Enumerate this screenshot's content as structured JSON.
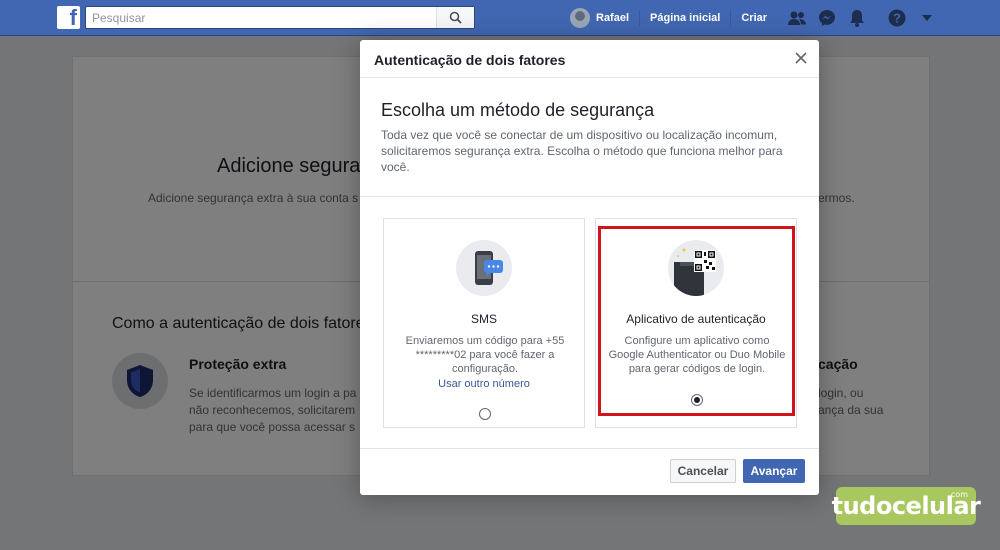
{
  "topbar": {
    "search_placeholder": "Pesquisar",
    "user_name": "Rafael",
    "home_label": "Página inicial",
    "create_label": "Criar",
    "brand_color": "#4267b2",
    "icons": [
      "friends-icon",
      "messenger-icon",
      "notifications-icon",
      "help-icon",
      "caret-down-icon"
    ]
  },
  "background_page": {
    "title_fragment": "Adicione seguranç",
    "subtitle_fragment": "Adicione segurança extra à sua conta s",
    "subtitle_right_fragment": "ermos.",
    "how_title_fragment": "Como a autenticação de dois fatore",
    "protection_title": "Proteção extra",
    "protection_text_lines": [
      "Se identificarmos um login a pa",
      "não reconhecemos, solicitarem",
      "para que você possa acessar s"
    ],
    "right_title_fragment": "cação",
    "right_text_lines": [
      "login, ou",
      "ança da sua"
    ]
  },
  "dialog": {
    "title": "Autenticação de dois fatores",
    "heading": "Escolha um método de segurança",
    "description": "Toda vez que você se conectar de um dispositivo ou localização incomum, solicitaremos segurança extra. Escolha o método que funciona melhor para você.",
    "options": [
      {
        "title": "SMS",
        "text": "Enviaremos um código para +55 *********02 para você fazer a configuração.",
        "link": "Usar outro número",
        "selected": false,
        "icon": "phone-sms-icon"
      },
      {
        "title": "Aplicativo de autenticação",
        "text": "Configure um aplicativo como Google Authenticator ou Duo Mobile para gerar códigos de login.",
        "selected": true,
        "icon": "qr-code-icon"
      }
    ],
    "cancel_label": "Cancelar",
    "next_label": "Avançar",
    "highlight_color": "#d0141c"
  },
  "watermark": {
    "text": "tudocelular",
    "suffix": ".com",
    "color": "#a9c75f"
  }
}
